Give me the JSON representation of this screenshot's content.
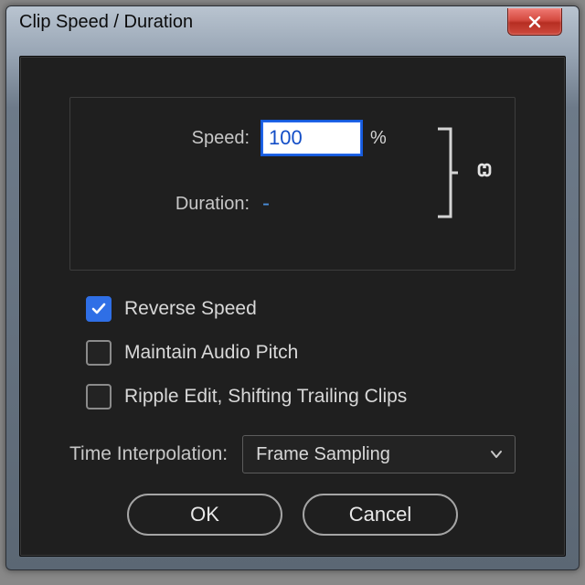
{
  "title": "Clip Speed / Duration",
  "speed": {
    "label": "Speed:",
    "value": "100",
    "unit": "%"
  },
  "duration": {
    "label": "Duration:",
    "value": "-"
  },
  "checks": {
    "reverse": {
      "label": "Reverse Speed",
      "checked": true
    },
    "pitch": {
      "label": "Maintain Audio Pitch",
      "checked": false
    },
    "ripple": {
      "label": "Ripple Edit, Shifting Trailing Clips",
      "checked": false
    }
  },
  "interp": {
    "label": "Time Interpolation:",
    "value": "Frame Sampling"
  },
  "buttons": {
    "ok": "OK",
    "cancel": "Cancel"
  }
}
